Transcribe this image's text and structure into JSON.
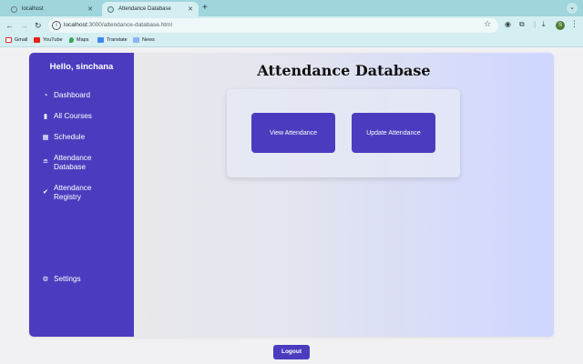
{
  "browser": {
    "tabs": [
      {
        "title": "localhost"
      },
      {
        "title": "Attendance Database"
      }
    ],
    "url_host": "localhost",
    "url_path": ":3000/attendance-database.html",
    "profile_initial": "S",
    "bookmarks": [
      {
        "label": "Gmail",
        "icon": "gmail-icon"
      },
      {
        "label": "YouTube",
        "icon": "youtube-icon"
      },
      {
        "label": "Maps",
        "icon": "maps-icon"
      },
      {
        "label": "Translate",
        "icon": "translate-icon"
      },
      {
        "label": "News",
        "icon": "news-icon"
      }
    ]
  },
  "sidebar": {
    "greeting": "Hello, sinchana",
    "items": [
      {
        "label": "Dashboard",
        "icon": "dashboard-icon"
      },
      {
        "label": "All Courses",
        "icon": "book-icon"
      },
      {
        "label": "Schedule",
        "icon": "calendar-icon"
      },
      {
        "label": "Attendance Database",
        "icon": "database-icon"
      },
      {
        "label": "Attendance Registry",
        "icon": "clipboard-check-icon"
      },
      {
        "label": "Settings",
        "icon": "gear-icon"
      }
    ]
  },
  "main": {
    "title": "Attendance Database",
    "buttons": {
      "view": "View Attendance",
      "update": "Update Attendance"
    }
  },
  "footer": {
    "logout": "Logout"
  },
  "colors": {
    "accent": "#4b3cbf",
    "chrome": "#d4eef1",
    "tabstrip": "#9fd5dc"
  }
}
